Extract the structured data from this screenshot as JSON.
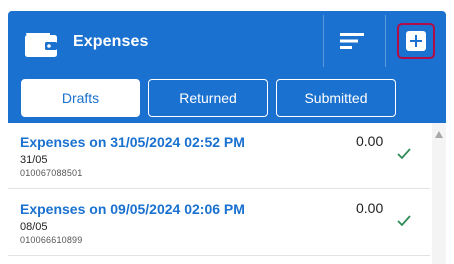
{
  "header": {
    "title": "Expenses",
    "icons": {
      "wallet": "wallet-icon",
      "sort": "sort-lines-icon",
      "add": "add-plus-icon"
    },
    "colors": {
      "brand": "#1a71cf",
      "highlight": "#b00d49"
    }
  },
  "tabs": [
    {
      "label": "Drafts",
      "active": true
    },
    {
      "label": "Returned",
      "active": false
    },
    {
      "label": "Submitted",
      "active": false
    }
  ],
  "expenses": [
    {
      "title": "Expenses on 31/05/2024 02:52 PM",
      "amount": "0.00",
      "date": "31/05",
      "id": "010067088501",
      "status_icon": "checkmark-icon"
    },
    {
      "title": "Expenses on 09/05/2024 02:06 PM",
      "amount": "0.00",
      "date": "08/05",
      "id": "010066610899",
      "status_icon": "checkmark-icon"
    }
  ]
}
